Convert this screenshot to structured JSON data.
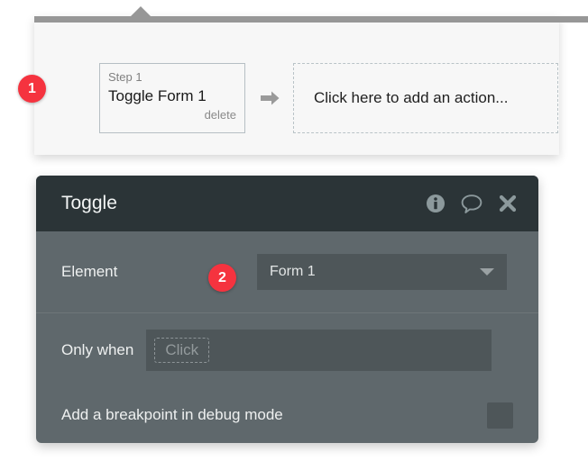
{
  "workflow": {
    "step": {
      "label": "Step 1",
      "title": "Toggle Form 1",
      "delete_label": "delete"
    },
    "arrow_icon": "arrow-right-icon",
    "add_action_text": "Click here to add an action..."
  },
  "badges": [
    {
      "number": "1"
    },
    {
      "number": "2"
    }
  ],
  "properties_panel": {
    "title": "Toggle",
    "header_icons": [
      {
        "name": "info-icon"
      },
      {
        "name": "comment-icon"
      },
      {
        "name": "close-icon"
      }
    ],
    "rows": {
      "element": {
        "label": "Element",
        "dropdown_value": "Form 1"
      },
      "only_when": {
        "label": "Only when",
        "chip_value": "Click"
      },
      "breakpoint": {
        "label": "Add a breakpoint in debug mode",
        "checked": false
      }
    }
  },
  "colors": {
    "badge_red": "#f5333f",
    "panel_header_dark": "#2b3437",
    "panel_body_gray": "#5f686c",
    "field_gray": "#4e5659",
    "top_bar_gray": "#979797"
  }
}
